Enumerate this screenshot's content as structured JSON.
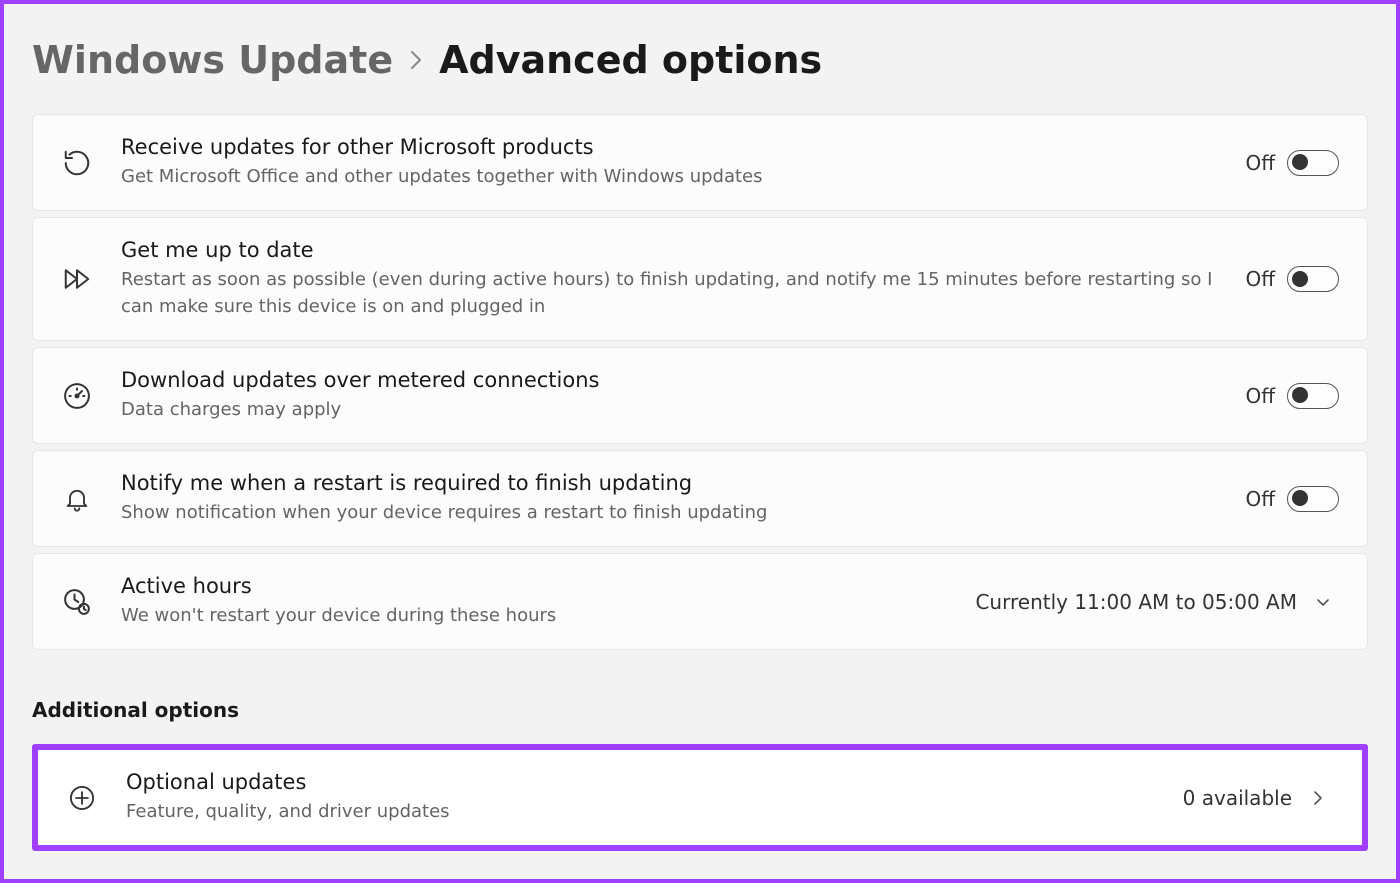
{
  "breadcrumb": {
    "parent": "Windows Update",
    "current": "Advanced options"
  },
  "rows": {
    "receive_updates": {
      "title": "Receive updates for other Microsoft products",
      "desc": "Get Microsoft Office and other updates together with Windows updates",
      "state": "Off"
    },
    "up_to_date": {
      "title": "Get me up to date",
      "desc": "Restart as soon as possible (even during active hours) to finish updating, and notify me 15 minutes before restarting so I can make sure this device is on and plugged in",
      "state": "Off"
    },
    "metered": {
      "title": "Download updates over metered connections",
      "desc": "Data charges may apply",
      "state": "Off"
    },
    "notify": {
      "title": "Notify me when a restart is required to finish updating",
      "desc": "Show notification when your device requires a restart to finish updating",
      "state": "Off"
    },
    "active_hours": {
      "title": "Active hours",
      "desc": "We won't restart your device during these hours",
      "value": "Currently 11:00 AM to 05:00 AM"
    },
    "optional": {
      "title": "Optional updates",
      "desc": "Feature, quality, and driver updates",
      "value": "0 available"
    }
  },
  "section_heading": "Additional options"
}
